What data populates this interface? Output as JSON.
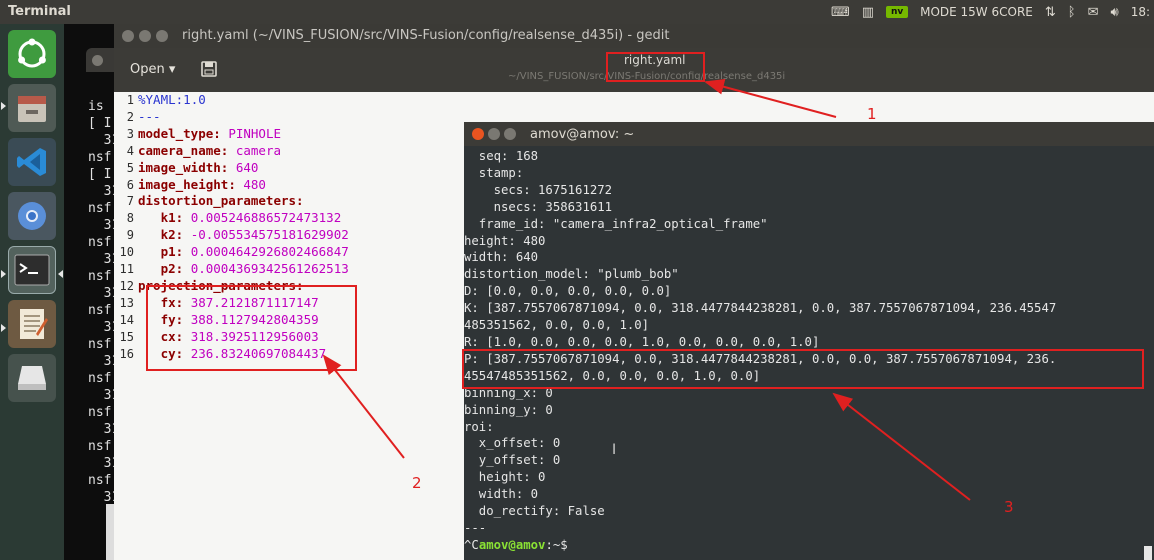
{
  "top_panel": {
    "title": "Terminal",
    "power_mode": "MODE 15W 6CORE",
    "clock": "18:"
  },
  "launcher": {
    "items": [
      {
        "name": "ubuntu-icon",
        "label": ""
      },
      {
        "name": "files-icon",
        "label": ""
      },
      {
        "name": "vscode-icon",
        "label": ""
      },
      {
        "name": "chromium-icon",
        "label": ""
      },
      {
        "name": "terminal-icon",
        "label": ""
      },
      {
        "name": "text-editor-icon",
        "label": ""
      },
      {
        "name": "drive-icon",
        "label": ""
      }
    ]
  },
  "bg_terminal": {
    "lines": [
      "is",
      "[ I",
      "  31",
      "nsf",
      "[ I",
      "  31",
      "nsf",
      "  31",
      "nsf",
      "  31",
      "nsf",
      "  31",
      "nsf",
      "  31",
      "nsf",
      "  31",
      "nsf",
      "  31",
      "nsf",
      "  31",
      "nsf",
      "  31",
      "nsf",
      "  31"
    ]
  },
  "gedit": {
    "window_title": "right.yaml (~/VINS_FUSION/src/VINS-Fusion/config/realsense_d435i) - gedit",
    "open_label": "Open",
    "header_file": "right.yaml",
    "header_path": "~/VINS_FUSION/src/VINS-Fusion/config/realsense_d435i",
    "code_lines": [
      {
        "n": "1",
        "key": "%YAML",
        "sep": ":",
        "val": "1.0",
        "kind": "hdr"
      },
      {
        "n": "2",
        "key": "",
        "sep": "",
        "val": "---",
        "kind": "hdr"
      },
      {
        "n": "3",
        "key": "model_type",
        "sep": ": ",
        "val": "PINHOLE",
        "kind": "kv"
      },
      {
        "n": "4",
        "key": "camera_name",
        "sep": ": ",
        "val": "camera",
        "kind": "kv"
      },
      {
        "n": "5",
        "key": "image_width",
        "sep": ": ",
        "val": "640",
        "kind": "kv"
      },
      {
        "n": "6",
        "key": "image_height",
        "sep": ": ",
        "val": "480",
        "kind": "kv"
      },
      {
        "n": "7",
        "key": "distortion_parameters",
        "sep": ":",
        "val": "",
        "kind": "kv"
      },
      {
        "n": "8",
        "key": "   k1",
        "sep": ": ",
        "val": "0.005246886572473132",
        "kind": "kv"
      },
      {
        "n": "9",
        "key": "   k2",
        "sep": ": ",
        "val": "-0.005534575181629902",
        "kind": "kv"
      },
      {
        "n": "10",
        "key": "   p1",
        "sep": ": ",
        "val": "0.0004642926802466847",
        "kind": "kv"
      },
      {
        "n": "11",
        "key": "   p2",
        "sep": ": ",
        "val": "0.0004369342561262513",
        "kind": "kv"
      },
      {
        "n": "12",
        "key": "projection_parameters",
        "sep": ":",
        "val": "",
        "kind": "kv"
      },
      {
        "n": "13",
        "key": "   fx",
        "sep": ": ",
        "val": "387.2121871117147",
        "kind": "kv"
      },
      {
        "n": "14",
        "key": "   fy",
        "sep": ": ",
        "val": "388.1127942804359",
        "kind": "kv"
      },
      {
        "n": "15",
        "key": "   cx",
        "sep": ": ",
        "val": "318.3925112956003",
        "kind": "kv"
      },
      {
        "n": "16",
        "key": "   cy",
        "sep": ": ",
        "val": "236.83240697084437",
        "kind": "kv"
      }
    ]
  },
  "terminal": {
    "title": "amov@amov: ~",
    "lines": [
      "  seq: 168",
      "  stamp:",
      "    secs: 1675161272",
      "    nsecs: 358631611",
      "  frame_id: \"camera_infra2_optical_frame\"",
      "height: 480",
      "width: 640",
      "distortion_model: \"plumb_bob\"",
      "D: [0.0, 0.0, 0.0, 0.0, 0.0]",
      "K: [387.7557067871094, 0.0, 318.4477844238281, 0.0, 387.7557067871094, 236.45547",
      "485351562, 0.0, 0.0, 1.0]",
      "R: [1.0, 0.0, 0.0, 0.0, 1.0, 0.0, 0.0, 0.0, 1.0]",
      "P: [387.7557067871094, 0.0, 318.4477844238281, 0.0, 0.0, 387.7557067871094, 236.",
      "45547485351562, 0.0, 0.0, 0.0, 1.0, 0.0]",
      "binning_x: 0",
      "binning_y: 0",
      "roi:",
      "  x_offset: 0",
      "  y_offset: 0",
      "  height: 0",
      "  width: 0",
      "  do_rectify: False",
      "---"
    ],
    "prompt_caret": "^C",
    "prompt_user": "amov@amov",
    "prompt_rest": ":~$"
  },
  "annotations": {
    "label_1": "1",
    "label_2": "2",
    "label_3": "3",
    "color": "#e02020"
  }
}
